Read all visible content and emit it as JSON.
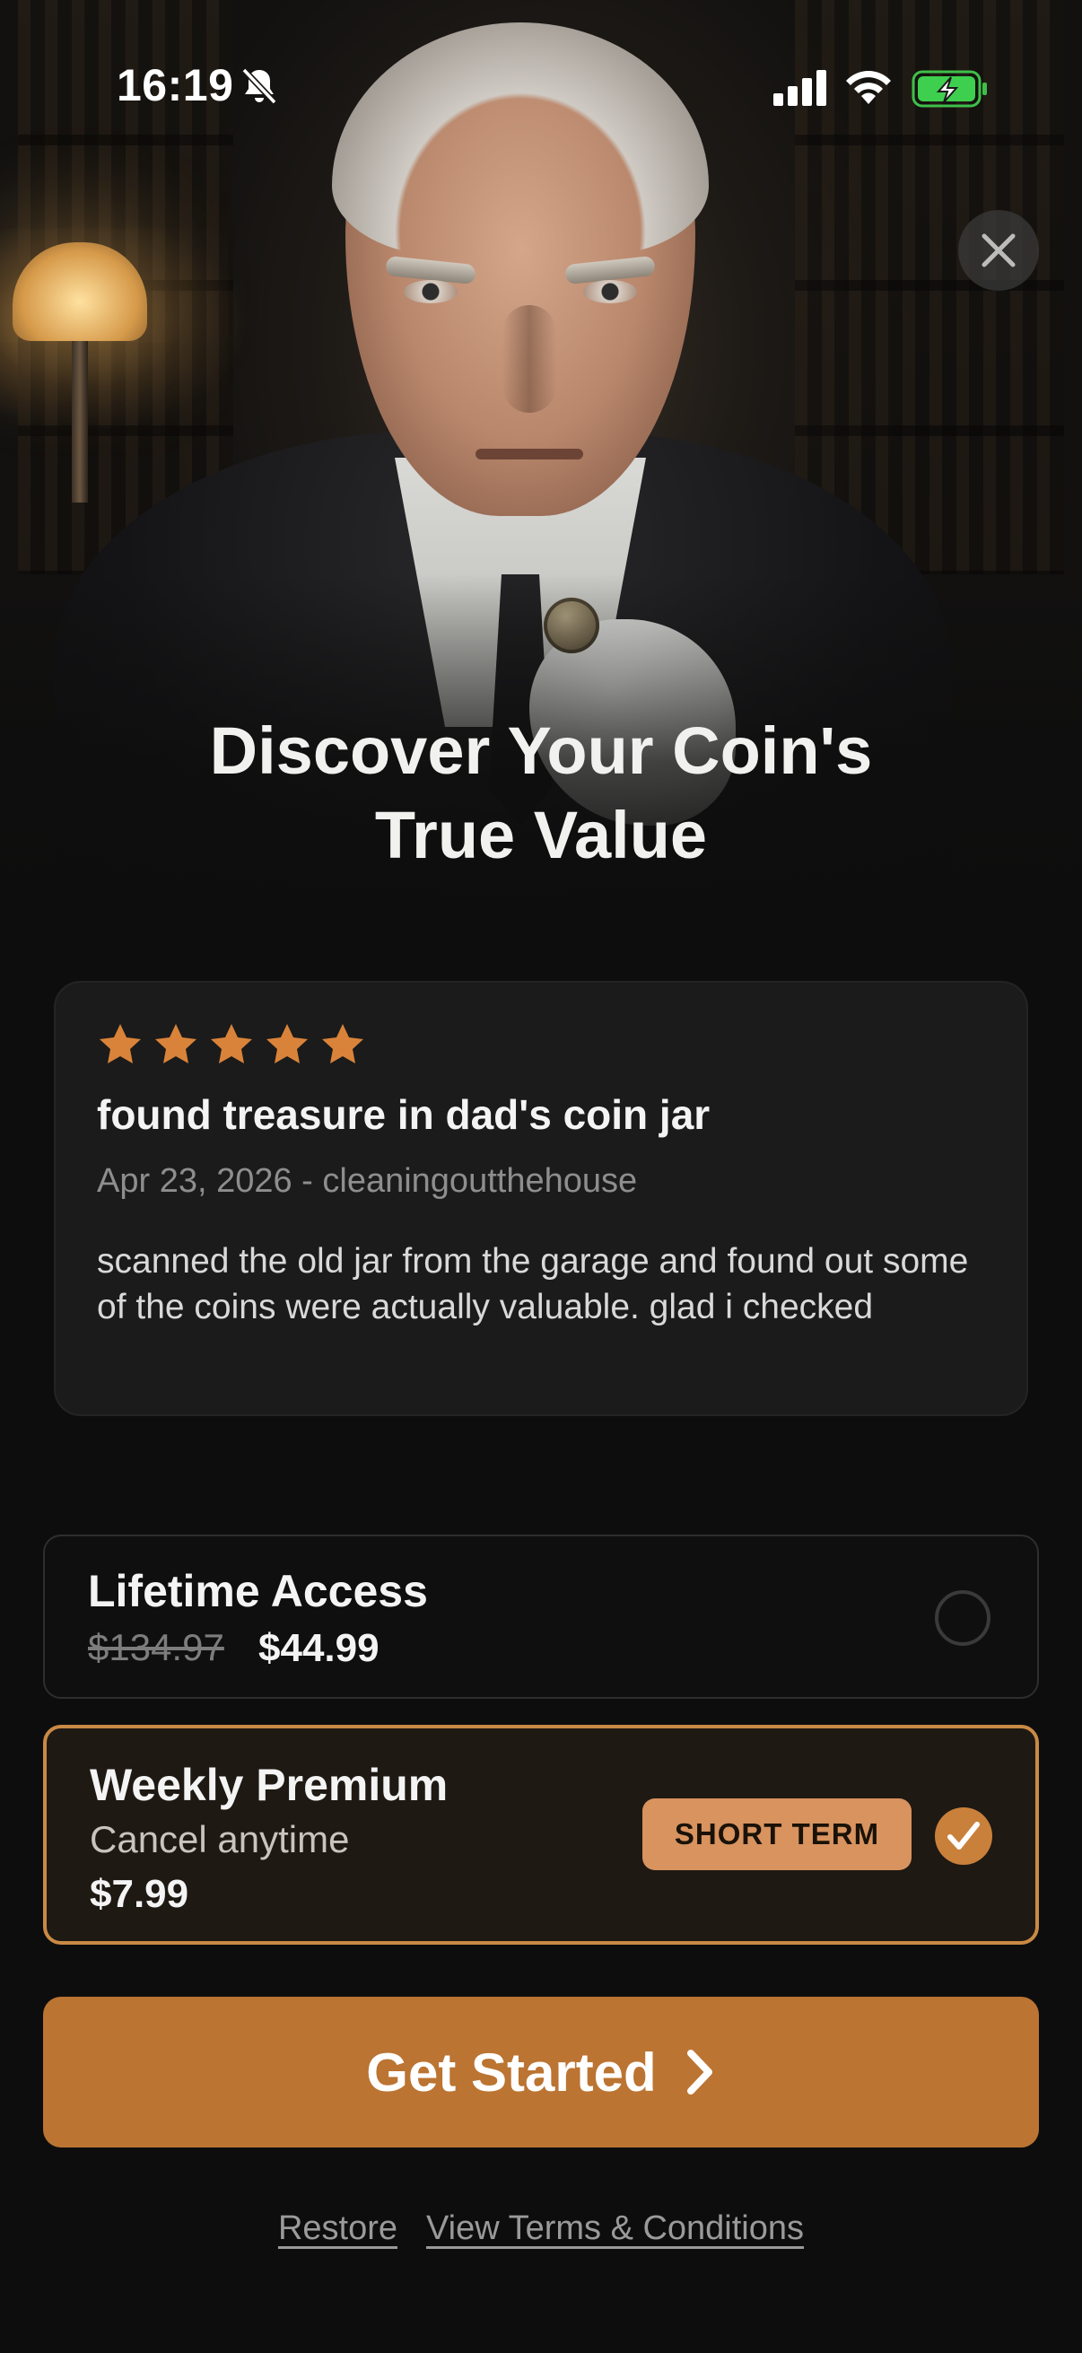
{
  "status_bar": {
    "time": "16:19",
    "icons": [
      "mute-bell-icon",
      "cellular-signal-icon",
      "wifi-icon",
      "battery-charging-icon"
    ]
  },
  "hero": {
    "close_icon": "close-icon",
    "headline_line1": "Discover Your Coin's",
    "headline_line2": "True Value"
  },
  "review": {
    "rating": 5,
    "star_icon": "star-icon",
    "star_color": "#d9833a",
    "title": "found treasure in dad's coin jar",
    "meta": "Apr 23, 2026 - cleaningoutthehouse",
    "body": "scanned the old jar from the garage and found out some of the coins were actually valuable. glad i checked"
  },
  "plans": [
    {
      "name": "Lifetime Access",
      "old_price": "$134.97",
      "price": "$44.99",
      "selected": false
    },
    {
      "name": "Weekly Premium",
      "subtitle": "Cancel anytime",
      "price": "$7.99",
      "badge": "SHORT TERM",
      "selected": true
    }
  ],
  "cta": {
    "label": "Get Started",
    "icon": "chevron-right-icon"
  },
  "footer": {
    "restore": "Restore",
    "terms": "View Terms & Conditions"
  },
  "colors": {
    "accent": "#bb7432",
    "selected_border": "#c98a45",
    "badge_bg": "#d8935f",
    "background": "#0d0d0d",
    "card_bg": "#1b1b1b"
  }
}
